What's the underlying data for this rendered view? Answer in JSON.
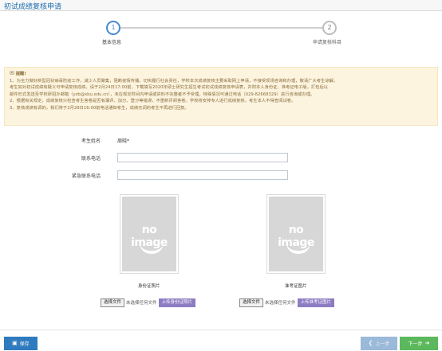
{
  "header": {
    "title": "初试成绩复核申请"
  },
  "steps": [
    {
      "number": "1",
      "label": "基本信息",
      "active": true
    },
    {
      "number": "2",
      "label": "申请复核科目",
      "active": false
    }
  ],
  "notice": {
    "heading": "提醒!",
    "lines": [
      "1、为全力做好新型冠状病毒防疫工作，减少人员聚集，阻断疫情传播，切实履行社会责任，学校本次成绩复核主要采取网上申请，不接受现场咨询和办理，敬请广大考生谅解。",
      "考生如对初试成绩有疑义可申请复核成绩，请于2月24日17:00前，下载填写2020年硕士研究生招生考试初试成绩复核申请表，并附本人身份证、准考证电子版，打包后以",
      "邮件形式发送至学校研招办邮箱（yzb@xbu.edu.cn），未在规定时间内申请或资料不完整者不予受理。特殊情况可通过电话（029-82668329）进行咨询或办理。",
      "2、根据有关规定，成绩复核只检查考生答卷是否有漏评、加分、登分等错误，不重新评阅答卷。学校将安排专人进行成绩复核，考生本人不得查阅试卷。",
      "3、复核成绩有调的，我们将于2月28日16:00前电话通知考生，成绩无调的考生不再进行回复。"
    ]
  },
  "form": {
    "name_label": "考生姓名",
    "name_value": "周晓*",
    "phone_label": "联系电话",
    "phone_value": "",
    "emergency_label": "紧急联系电话",
    "emergency_value": ""
  },
  "photos": {
    "placeholder_text": "no image",
    "id_card": {
      "caption": "身份证照片",
      "choose_label": "选择文件",
      "no_file_text": "未选择任何文件",
      "upload_label": "上传身份证照片"
    },
    "admission": {
      "caption": "准考证图片",
      "choose_label": "选择文件",
      "no_file_text": "未选择任何文件",
      "upload_label": "上传准考证图片"
    }
  },
  "footer": {
    "save_label": "保存",
    "prev_label": "上一步",
    "next_label": "下一步"
  },
  "icons": {
    "bell": "bell-icon",
    "save": "floppy-icon",
    "prev": "arrow-left-icon",
    "next": "arrow-right-icon"
  },
  "colors": {
    "accent": "#4a8ad1",
    "save_button": "#2f7bbf",
    "next_button": "#5cb85c",
    "prev_button": "#9bb9d9",
    "upload_button": "#8e7cc3",
    "notice_bg": "#fcf4df"
  }
}
